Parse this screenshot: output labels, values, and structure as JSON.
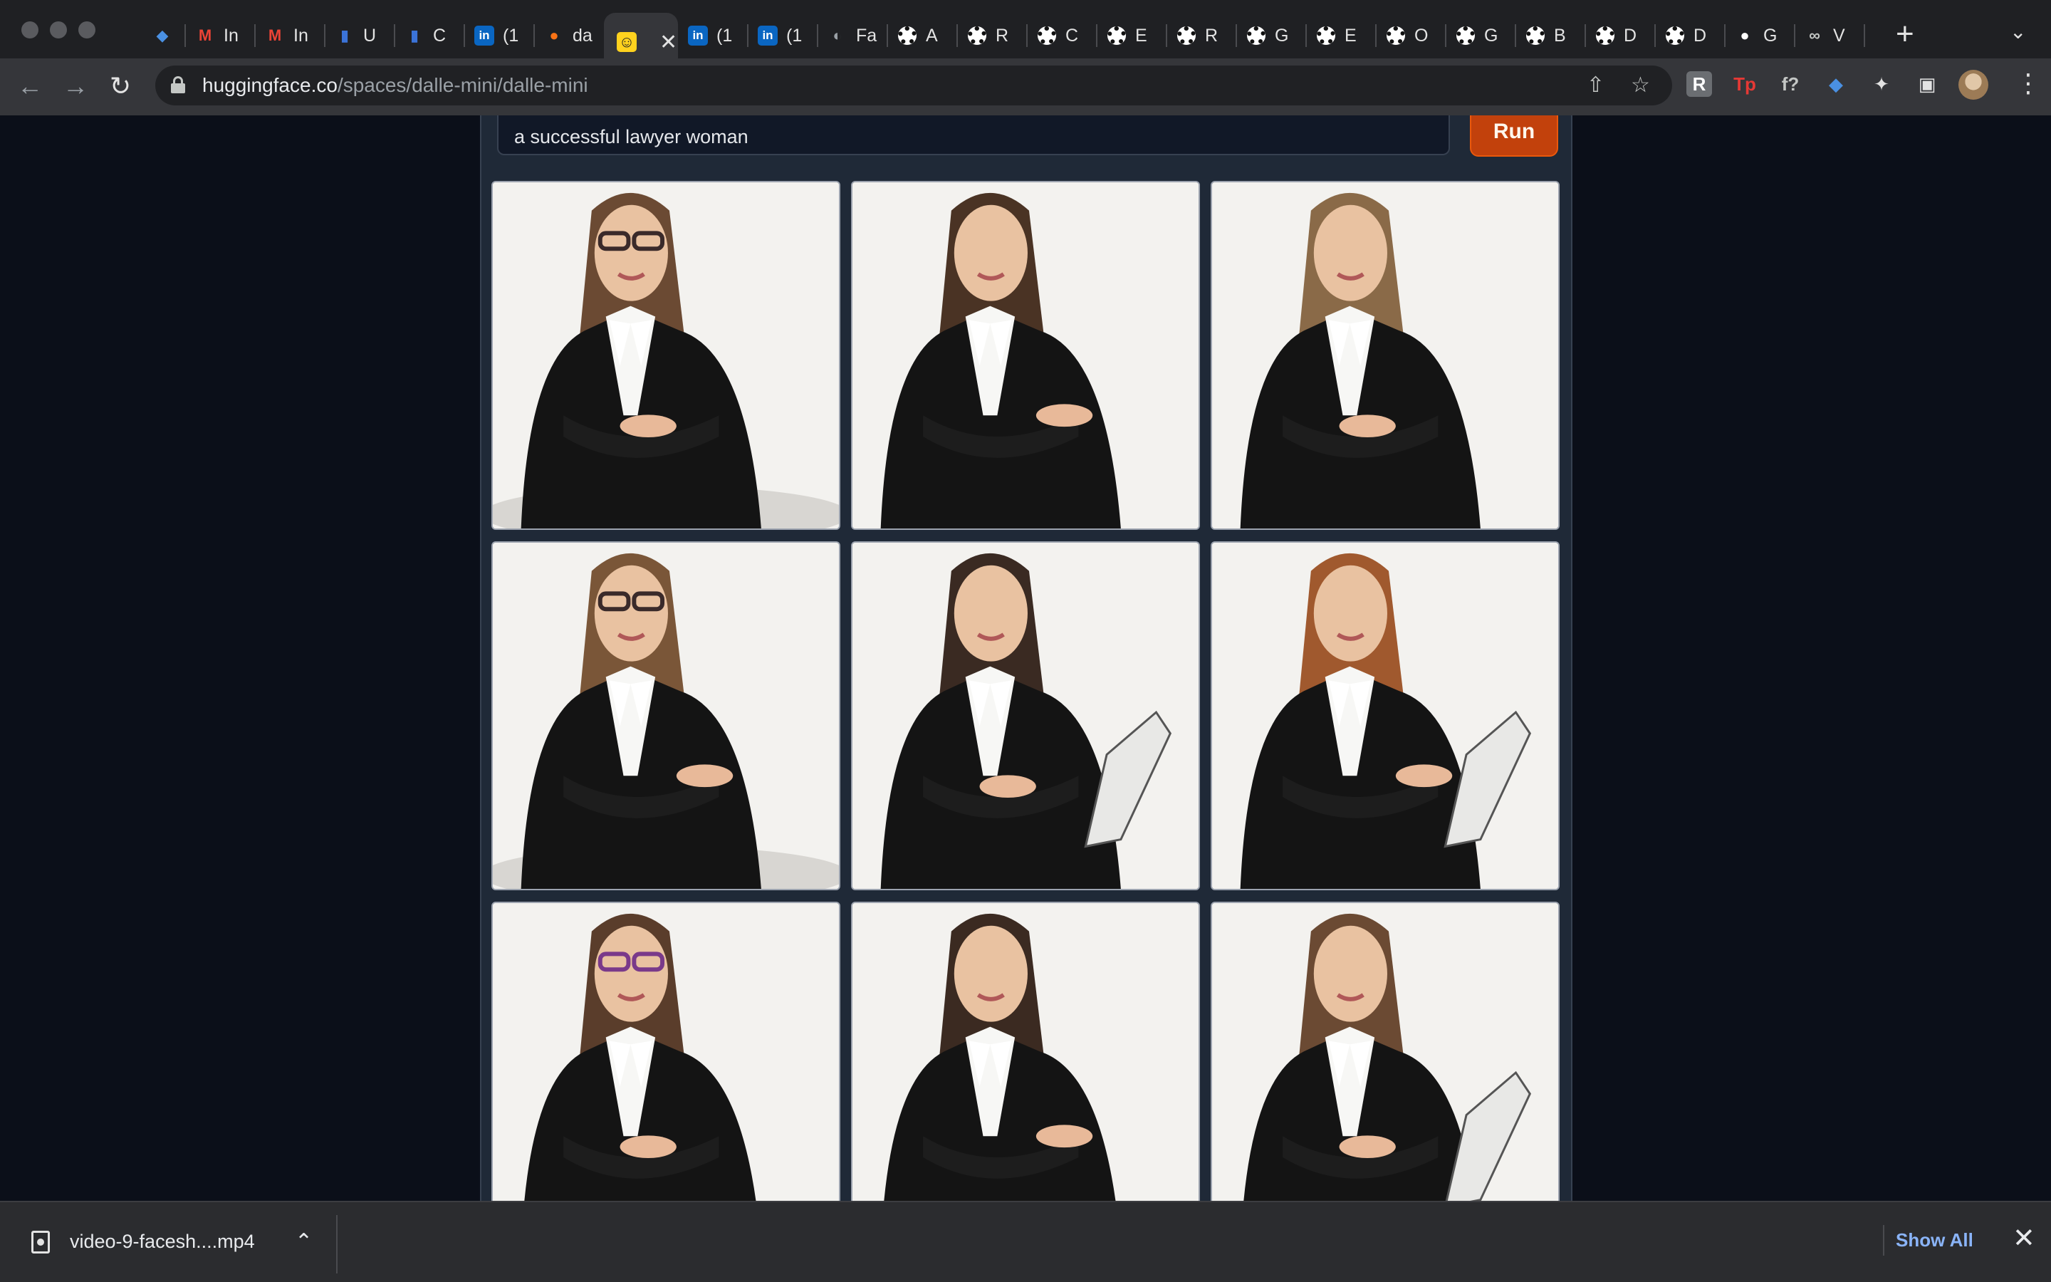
{
  "browser": {
    "tabs": [
      {
        "icon": "diamond-icon",
        "label": ""
      },
      {
        "icon": "gmail-icon",
        "label": "In"
      },
      {
        "icon": "gmail-icon",
        "label": "In"
      },
      {
        "icon": "bar-chart-icon",
        "label": "U"
      },
      {
        "icon": "bar-chart-icon",
        "label": "C"
      },
      {
        "icon": "linkedin-icon",
        "label": "(1"
      },
      {
        "icon": "orange-circle-icon",
        "label": "da"
      },
      {
        "icon": "huggingface-icon",
        "label": "",
        "active": true
      },
      {
        "icon": "linkedin-icon",
        "label": "(1"
      },
      {
        "icon": "linkedin-icon",
        "label": "(1"
      },
      {
        "icon": "globe-icon",
        "label": "Fa"
      },
      {
        "icon": "openai-icon",
        "label": "A"
      },
      {
        "icon": "openai-icon",
        "label": "R"
      },
      {
        "icon": "openai-icon",
        "label": "C"
      },
      {
        "icon": "openai-icon",
        "label": "E"
      },
      {
        "icon": "openai-icon",
        "label": "R"
      },
      {
        "icon": "openai-icon",
        "label": "G"
      },
      {
        "icon": "openai-icon",
        "label": "E"
      },
      {
        "icon": "openai-icon",
        "label": "O"
      },
      {
        "icon": "openai-icon",
        "label": "G"
      },
      {
        "icon": "openai-icon",
        "label": "B"
      },
      {
        "icon": "openai-icon",
        "label": "D"
      },
      {
        "icon": "openai-icon",
        "label": "D"
      },
      {
        "icon": "github-icon",
        "label": "G"
      },
      {
        "icon": "infinity-icon",
        "label": "V"
      }
    ],
    "tab_close_glyph": "✕",
    "new_tab_glyph": "+",
    "tab_menu_glyph": "⌄",
    "url_host": "huggingface.co",
    "url_path": "/spaces/dalle-mini/dalle-mini",
    "back_glyph": "←",
    "forward_glyph": "→",
    "reload_glyph": "↻",
    "share_glyph": "⇧",
    "bookmark_glyph": "☆",
    "extensions": [
      {
        "icon": "extension-r-icon",
        "glyph": "R",
        "color": "#9aa0a6"
      },
      {
        "icon": "extension-tp-icon",
        "glyph": "Tp",
        "color": "#e53935"
      },
      {
        "icon": "extension-fx-icon",
        "glyph": "f?",
        "color": "#c4c7c5"
      },
      {
        "icon": "extension-diamond-icon",
        "glyph": "◆",
        "color": "#4a90e2"
      },
      {
        "icon": "puzzle-icon",
        "glyph": "✦",
        "color": "#e3e3e3"
      },
      {
        "icon": "sidepanel-icon",
        "glyph": "▣",
        "color": "#e3e3e3"
      }
    ],
    "menu_glyph": "⋮"
  },
  "app": {
    "prompt_value": "a successful lawyer woman",
    "run_label": "Run",
    "gallery_count": 9
  },
  "downloads": {
    "filename": "video-9-facesh....mp4",
    "chevron_glyph": "⌃",
    "show_all_label": "Show All",
    "close_glyph": "✕"
  },
  "colors": {
    "page_bg": "#0b0f19",
    "panel_bg": "#1f2937",
    "run_button": "#c2410c",
    "link_blue": "#8ab4f8"
  }
}
